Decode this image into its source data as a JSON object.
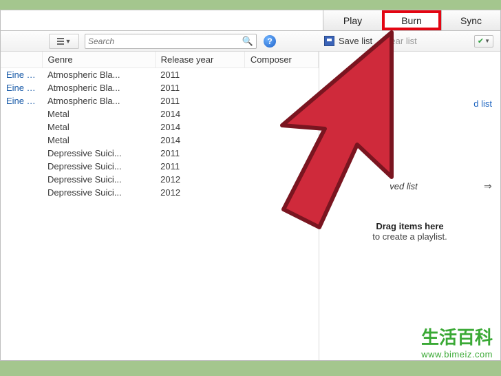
{
  "tabs": {
    "play": "Play",
    "burn": "Burn",
    "sync": "Sync"
  },
  "toolbar": {
    "search_placeholder": "Search",
    "save_list": "Save list",
    "clear_list": "Clear list"
  },
  "columns": {
    "genre": "Genre",
    "release_year": "Release year",
    "composer": "Composer"
  },
  "rows": [
    {
      "first": "Eine R...",
      "genre": "Atmospheric Bla...",
      "year": "2011"
    },
    {
      "first": "Eine R...",
      "genre": "Atmospheric Bla...",
      "year": "2011"
    },
    {
      "first": "Eine R...",
      "genre": "Atmospheric Bla...",
      "year": "2011"
    },
    {
      "first": "",
      "genre": "Metal",
      "year": "2014"
    },
    {
      "first": "",
      "genre": "Metal",
      "year": "2014"
    },
    {
      "first": "",
      "genre": "Metal",
      "year": "2014"
    },
    {
      "first": "",
      "genre": "Depressive Suici...",
      "year": "2011"
    },
    {
      "first": "",
      "genre": "Depressive Suici...",
      "year": "2011"
    },
    {
      "first": "",
      "genre": "Depressive Suici...",
      "year": "2012"
    },
    {
      "first": "",
      "genre": "Depressive Suici...",
      "year": "2012"
    }
  ],
  "right_panel": {
    "link": "d list",
    "playlist_name": "ved list",
    "drag_l1": "Drag items here",
    "drag_l2": "to create a playlist."
  },
  "watermark": {
    "cn": "生活百科",
    "url": "www.bimeiz.com"
  }
}
